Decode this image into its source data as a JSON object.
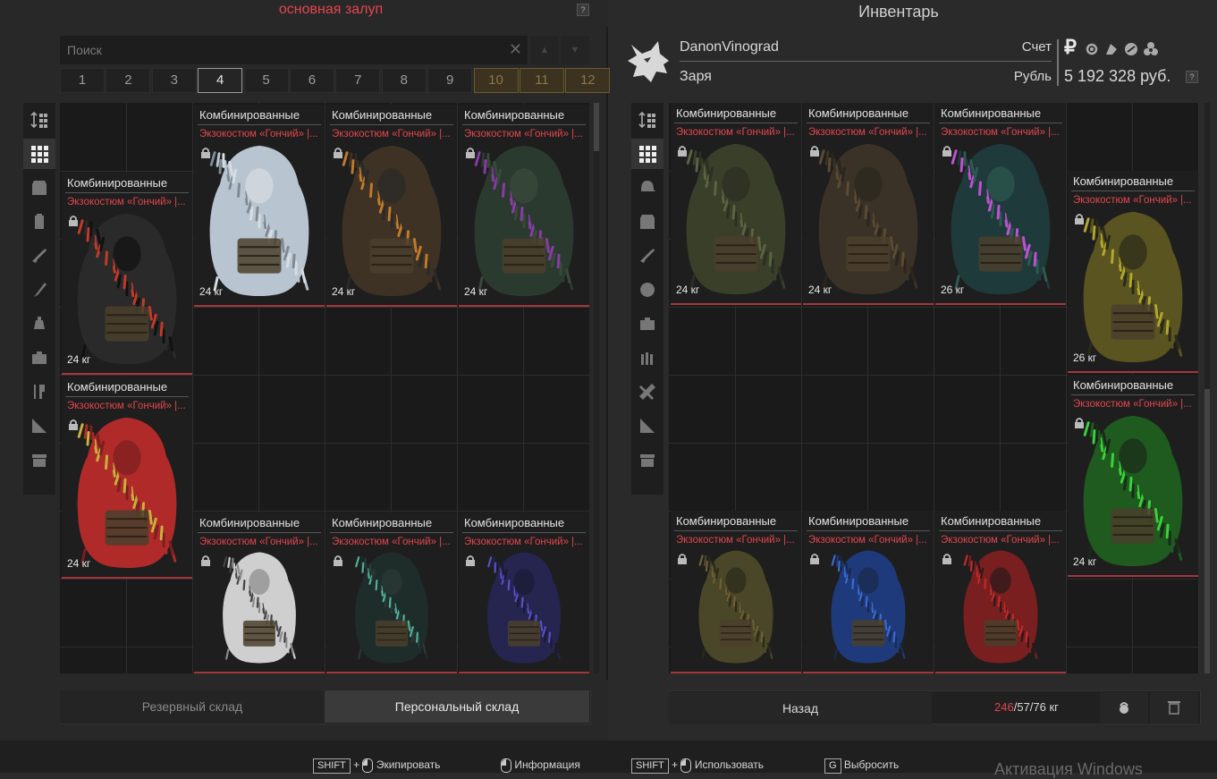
{
  "left": {
    "title": "основная залуп",
    "help": "?",
    "search": {
      "placeholder": "Поиск",
      "clear": "✕",
      "up": "▲",
      "down": "▼"
    },
    "pages": [
      "1",
      "2",
      "3",
      "4",
      "5",
      "6",
      "7",
      "8",
      "9",
      "10",
      "11",
      "12"
    ],
    "active_page": "4",
    "tabs": [
      "Резервный склад",
      "Персональный склад"
    ],
    "active_tab": 1
  },
  "right": {
    "title": "Инвентарь",
    "player": {
      "name": "DanonVinograd",
      "clan": "Заря"
    },
    "account_label": "Счет",
    "currency_label": "Рубль",
    "balance": "5 192 328 руб.",
    "help": "?",
    "back": "Назад",
    "weight": {
      "current": "246",
      "rest": "/57/76 кг"
    }
  },
  "item": {
    "title": "Комбинированные",
    "subtitle": "Экзокостюм «Гончий» |...",
    "subtitle_full": "Экзокостюм «Гончий»"
  },
  "left_items": [
    {
      "weight": "24 кг",
      "colors": [
        "#2a2a2a",
        "#c23a2a",
        "#111111"
      ]
    },
    {
      "weight": "24 кг",
      "colors": [
        "#b8c4cf",
        "#7e8a95",
        "#d8dde2"
      ]
    },
    {
      "weight": "24 кг",
      "colors": [
        "#3d3224",
        "#c27a2a",
        "#2a2a2a"
      ]
    },
    {
      "weight": "24 кг",
      "colors": [
        "#2a3a2f",
        "#8a3aa8",
        "#3a4a3a"
      ]
    },
    {
      "weight": "24 кг",
      "colors": [
        "#b02a2a",
        "#c9b23a",
        "#7a1f1f"
      ]
    },
    {
      "weight": "",
      "colors": [
        "#cfcfcf",
        "#444444",
        "#8a8a8a"
      ]
    },
    {
      "weight": "",
      "colors": [
        "#1f2d2a",
        "#4fb39a",
        "#2b3a37"
      ]
    },
    {
      "weight": "",
      "colors": [
        "#252550",
        "#5a4fc7",
        "#1a1a33"
      ]
    }
  ],
  "right_items": [
    {
      "weight": "24 кг",
      "colors": [
        "#3a3f2a",
        "#5a6441",
        "#2c2f22"
      ]
    },
    {
      "weight": "24 кг",
      "colors": [
        "#3a3226",
        "#5b4b33",
        "#2a261e"
      ]
    },
    {
      "weight": "26 кг",
      "colors": [
        "#1f3a3a",
        "#c24fd6",
        "#2d5a4f"
      ]
    },
    {
      "weight": "26 кг",
      "colors": [
        "#5a5420",
        "#b3a82a",
        "#2a2a1a"
      ]
    },
    {
      "weight": "24 кг",
      "colors": [
        "#1f5a1f",
        "#3ad33a",
        "#1a2a1a"
      ]
    },
    {
      "weight": "",
      "colors": [
        "#4a4628",
        "#6f5f36",
        "#2a2a1a"
      ]
    },
    {
      "weight": "",
      "colors": [
        "#1f3a7a",
        "#3a6ad3",
        "#1a2a4a"
      ]
    },
    {
      "weight": "",
      "colors": [
        "#7a1f1f",
        "#c22a2a",
        "#2a1a1a"
      ]
    }
  ],
  "hints": [
    {
      "key": "SHIFT",
      "plus": "+",
      "label": "Экипировать"
    },
    {
      "label": "Информация"
    },
    {
      "key": "SHIFT",
      "plus": "+",
      "label": "Использовать"
    },
    {
      "key": "G",
      "label": "Выбросить"
    }
  ],
  "watermark": "Активация Windows"
}
